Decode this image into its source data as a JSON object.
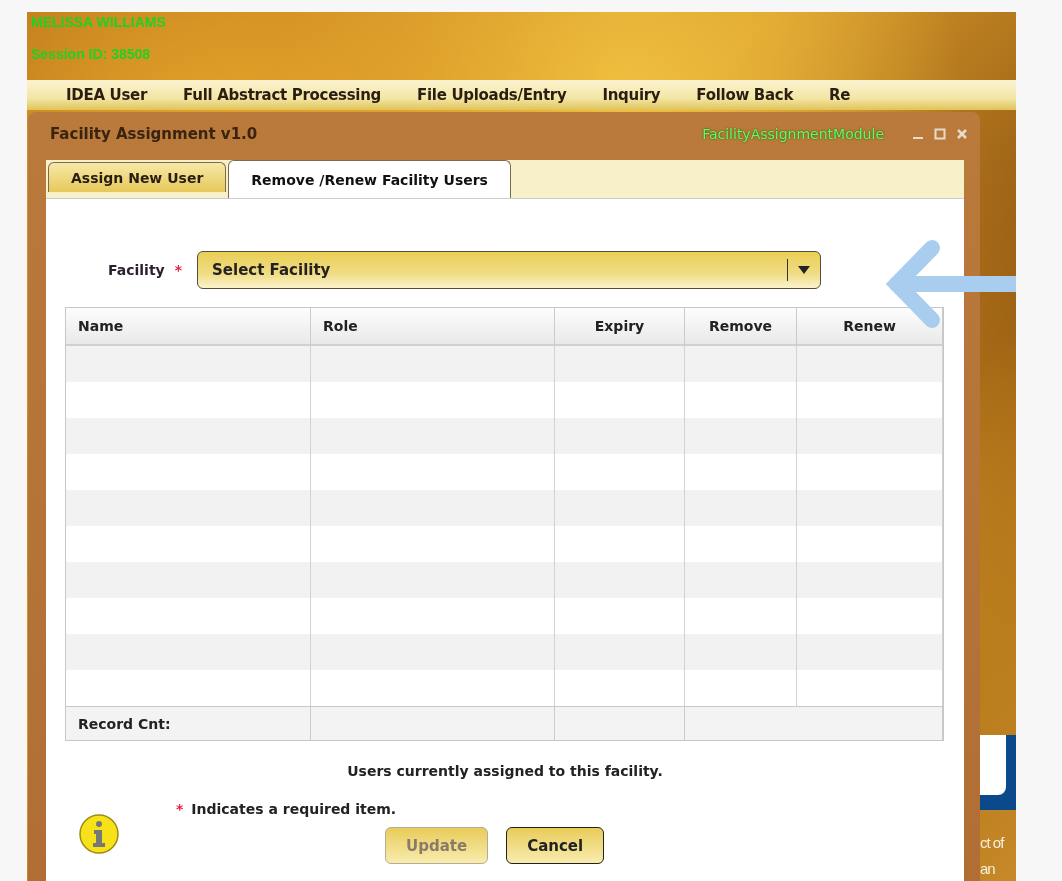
{
  "user": {
    "name": "MELISSA WILLIAMS",
    "session": "Session ID: 38508"
  },
  "menu": [
    {
      "label": "IDEA User"
    },
    {
      "label": "Full Abstract Processing"
    },
    {
      "label": "File Uploads/Entry"
    },
    {
      "label": "Inquiry"
    },
    {
      "label": "Follow Back"
    },
    {
      "label": "Re"
    }
  ],
  "window": {
    "title": "Facility Assignment v1.0",
    "module": "FacilityAssignmentModule"
  },
  "tabs": [
    {
      "label": "Assign New User",
      "selected": false
    },
    {
      "label": "Remove /Renew Facility Users",
      "selected": true
    }
  ],
  "facility": {
    "label": "Facility",
    "required_mark": "*",
    "value": "Select Facility"
  },
  "table": {
    "columns": [
      "Name",
      "Role",
      "Expiry",
      "Remove",
      "Renew"
    ],
    "footer_label": "Record Cnt:"
  },
  "caption": "Users currently assigned to this facility.",
  "note": {
    "mark": "*",
    "text": "Indicates a required item."
  },
  "buttons": [
    {
      "label": "Update",
      "disabled": true
    },
    {
      "label": "Cancel",
      "disabled": false
    }
  ],
  "background_text": [
    "ct of",
    "an"
  ]
}
